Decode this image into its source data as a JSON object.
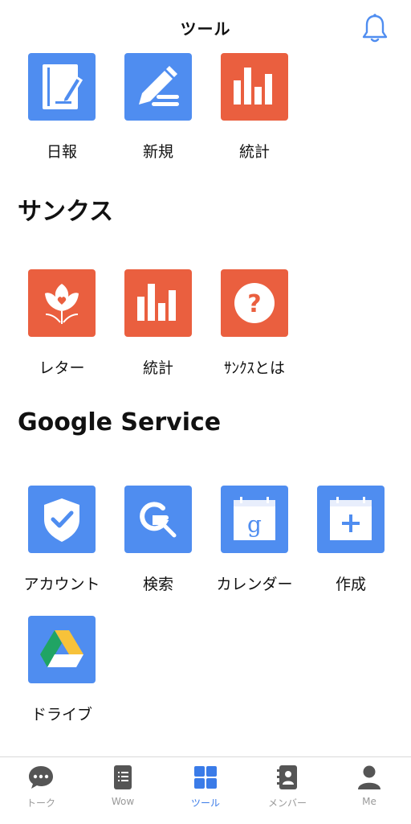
{
  "header": {
    "title": "ツール"
  },
  "tools": {
    "items": [
      {
        "label": "日報",
        "icon": "diary-icon"
      },
      {
        "label": "新規",
        "icon": "pencil-icon"
      },
      {
        "label": "統計",
        "icon": "bar-chart-icon"
      }
    ]
  },
  "thanks": {
    "title": "サンクス",
    "items": [
      {
        "label": "レター",
        "icon": "flower-heart-icon"
      },
      {
        "label": "統計",
        "icon": "bar-chart-icon"
      },
      {
        "label": "ｻﾝｸｽとは",
        "icon": "question-icon"
      }
    ]
  },
  "google": {
    "title": "Google Service",
    "items": [
      {
        "label": "アカウント",
        "icon": "shield-check-icon"
      },
      {
        "label": "検索",
        "icon": "search-g-icon"
      },
      {
        "label": "カレンダー",
        "icon": "calendar-g-icon"
      },
      {
        "label": "作成",
        "icon": "calendar-plus-icon"
      },
      {
        "label": "ドライブ",
        "icon": "drive-icon"
      }
    ]
  },
  "tabbar": {
    "tabs": [
      {
        "label": "トーク",
        "icon": "chat-bubble-icon"
      },
      {
        "label": "Wow",
        "icon": "document-list-icon"
      },
      {
        "label": "ツール",
        "icon": "grid-icon"
      },
      {
        "label": "メンバー",
        "icon": "contact-book-icon"
      },
      {
        "label": "Me",
        "icon": "person-icon"
      }
    ],
    "active": "ツール"
  },
  "colors": {
    "blue": "#4f8df0",
    "red": "#ea5f3f",
    "active_tab": "#3a7be8",
    "inactive_tab": "#999999"
  }
}
